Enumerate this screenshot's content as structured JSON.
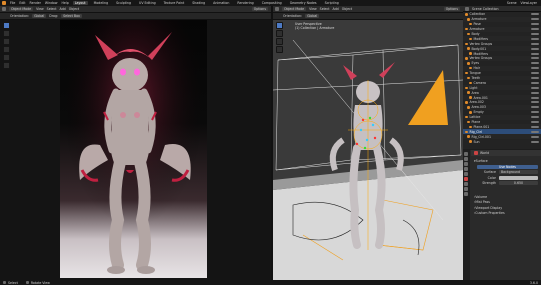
{
  "menu": {
    "items": [
      "File",
      "Edit",
      "Render",
      "Window",
      "Help"
    ],
    "workspaces": [
      "Layout",
      "Modeling",
      "Sculpting",
      "UV Editing",
      "Texture Paint",
      "Shading",
      "Animation",
      "Rendering",
      "Compositing",
      "Geometry Nodes",
      "Scripting"
    ],
    "active_workspace": "Layout",
    "scene": "Scene",
    "view_layer": "ViewLayer"
  },
  "left_viewport": {
    "header": [
      "Object Mode",
      "View",
      "Select",
      "Add",
      "Object"
    ],
    "orientation": "Global",
    "drag": "Select Box",
    "options": "Options"
  },
  "right_viewport": {
    "header": [
      "Object Mode",
      "View",
      "Select",
      "Add",
      "Object"
    ],
    "orientation": "Global",
    "overlay_label": "User Perspective",
    "overlay_sub": "(1) Collection | Armature",
    "options": "Options"
  },
  "outliner": {
    "title": "Scene Collection",
    "rows": [
      {
        "label": "Collection",
        "sel": false
      },
      {
        "label": "Armature",
        "sel": false
      },
      {
        "label": "Pose",
        "sel": false
      },
      {
        "label": "Armature",
        "sel": false
      },
      {
        "label": "Body",
        "sel": false
      },
      {
        "label": "Modifiers",
        "sel": false
      },
      {
        "label": "Vertex Groups",
        "sel": false
      },
      {
        "label": "Body.001",
        "sel": false
      },
      {
        "label": "Modifiers",
        "sel": false
      },
      {
        "label": "Vertex Groups",
        "sel": false
      },
      {
        "label": "Eyes",
        "sel": false
      },
      {
        "label": "Hair",
        "sel": false
      },
      {
        "label": "Tongue",
        "sel": false
      },
      {
        "label": "Teeth",
        "sel": false
      },
      {
        "label": "Camera",
        "sel": false
      },
      {
        "label": "Light",
        "sel": false
      },
      {
        "label": "Area",
        "sel": false
      },
      {
        "label": "Area.001",
        "sel": false
      },
      {
        "label": "Area.002",
        "sel": false
      },
      {
        "label": "Area.003",
        "sel": false
      },
      {
        "label": "Empty",
        "sel": false
      },
      {
        "label": "Lattice",
        "sel": false
      },
      {
        "label": "Plane",
        "sel": false
      },
      {
        "label": "Plane.001",
        "sel": false
      },
      {
        "label": "Rig_Ctrl",
        "sel": true
      },
      {
        "label": "Rig_Ctrl.001",
        "sel": false
      },
      {
        "label": "Sun",
        "sel": false
      }
    ]
  },
  "properties": {
    "tab_title": "World",
    "world_name": "World",
    "surface_header": "Surface",
    "use_nodes": "Use Nodes",
    "surface_label": "Surface",
    "surface_value": "Background",
    "color_label": "Color",
    "strength_label": "Strength",
    "strength_value": "0.650",
    "sections": [
      "Volume",
      "Mist Pass",
      "Viewport Display",
      "Custom Properties"
    ]
  },
  "status": {
    "left": "Select",
    "right": "Rotate View",
    "version": "3.6.0"
  },
  "colors": {
    "accent": "#4d7ac4",
    "orange": "#f0a020",
    "selected": "#2d4d7a"
  }
}
